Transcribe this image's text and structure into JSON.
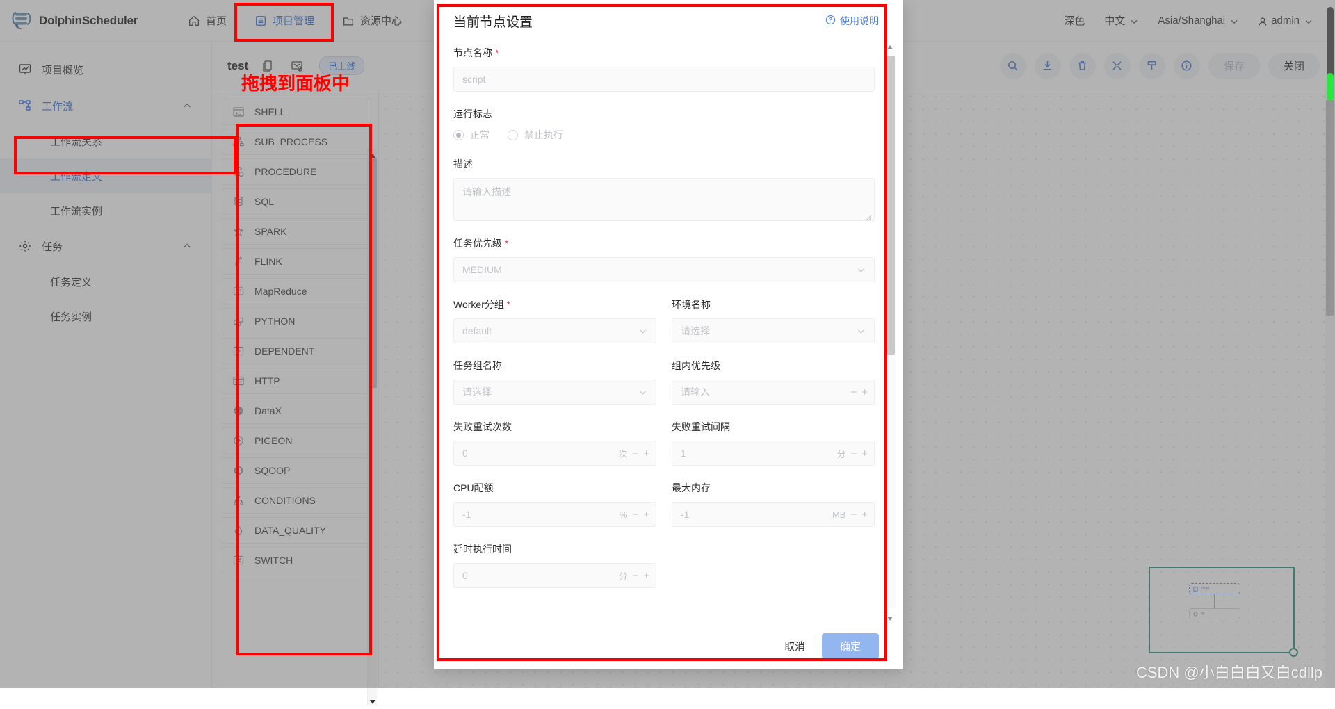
{
  "header": {
    "brand": "DolphinScheduler",
    "nav": [
      {
        "label": "首页",
        "icon": "home-icon",
        "active": false
      },
      {
        "label": "项目管理",
        "icon": "project-icon",
        "active": true
      },
      {
        "label": "资源中心",
        "icon": "folder-icon",
        "active": false
      }
    ],
    "right": {
      "theme": "深色",
      "language": "中文",
      "timezone": "Asia/Shanghai",
      "user": "admin"
    }
  },
  "sidebar": {
    "items": [
      {
        "label": "项目概览",
        "icon": "overview-icon",
        "level": 0,
        "state": "normal"
      },
      {
        "label": "工作流",
        "icon": "workflow-icon",
        "level": 0,
        "state": "active",
        "chevron": "chevron-up"
      },
      {
        "label": "工作流关系",
        "icon": "",
        "level": 1,
        "state": "normal"
      },
      {
        "label": "工作流定义",
        "icon": "",
        "level": 1,
        "state": "selected"
      },
      {
        "label": "工作流实例",
        "icon": "",
        "level": 1,
        "state": "normal"
      },
      {
        "label": "任务",
        "icon": "gear-icon",
        "level": 0,
        "state": "normal",
        "chevron": "chevron-up"
      },
      {
        "label": "任务定义",
        "icon": "",
        "level": 1,
        "state": "normal"
      },
      {
        "label": "任务实例",
        "icon": "",
        "level": 1,
        "state": "normal"
      }
    ]
  },
  "workflow": {
    "name": "test",
    "status_badge": "已上线",
    "toolbar_icons": [
      "search-icon",
      "download-icon",
      "delete-icon",
      "fullscreen-icon",
      "format-icon",
      "info-icon"
    ],
    "save_label": "保存",
    "close_label": "关闭"
  },
  "palette": {
    "items": [
      {
        "label": "SHELL",
        "icon": "shell-icon"
      },
      {
        "label": "SUB_PROCESS",
        "icon": "subprocess-icon"
      },
      {
        "label": "PROCEDURE",
        "icon": "procedure-icon"
      },
      {
        "label": "SQL",
        "icon": "sql-icon"
      },
      {
        "label": "SPARK",
        "icon": "spark-icon"
      },
      {
        "label": "FLINK",
        "icon": "flink-icon"
      },
      {
        "label": "MapReduce",
        "icon": "mapreduce-icon"
      },
      {
        "label": "PYTHON",
        "icon": "python-icon"
      },
      {
        "label": "DEPENDENT",
        "icon": "dependent-icon"
      },
      {
        "label": "HTTP",
        "icon": "http-icon"
      },
      {
        "label": "DataX",
        "icon": "datax-icon"
      },
      {
        "label": "PIGEON",
        "icon": "pigeon-icon"
      },
      {
        "label": "SQOOP",
        "icon": "sqoop-icon"
      },
      {
        "label": "CONDITIONS",
        "icon": "conditions-icon"
      },
      {
        "label": "DATA_QUALITY",
        "icon": "dataquality-icon"
      },
      {
        "label": "SWITCH",
        "icon": "switch-icon"
      }
    ]
  },
  "minimap": {
    "node_a": "script",
    "node_b": "py"
  },
  "modal": {
    "title": "当前节点设置",
    "help_label": "使用说明",
    "fields": {
      "node_name": {
        "label": "节点名称",
        "required": true,
        "placeholder": "script",
        "value": ""
      },
      "run_flag": {
        "label": "运行标志",
        "options": [
          {
            "label": "正常",
            "selected": true
          },
          {
            "label": "禁止执行",
            "selected": false
          }
        ]
      },
      "description": {
        "label": "描述",
        "required": false,
        "placeholder": "请输入描述",
        "value": ""
      },
      "task_priority": {
        "label": "任务优先级",
        "required": true,
        "value": "MEDIUM"
      },
      "worker_group": {
        "label": "Worker分组",
        "required": true,
        "value": "default"
      },
      "environment_name": {
        "label": "环境名称",
        "required": false,
        "placeholder": "请选择",
        "value": ""
      },
      "task_group_name": {
        "label": "任务组名称",
        "required": false,
        "placeholder": "请选择",
        "value": ""
      },
      "group_priority": {
        "label": "组内优先级",
        "required": false,
        "placeholder": "请输入",
        "value": ""
      },
      "failed_retry_times": {
        "label": "失败重试次数",
        "placeholder": "0",
        "unit": "次"
      },
      "failed_retry_interval": {
        "label": "失败重试间隔",
        "placeholder": "1",
        "unit": "分"
      },
      "cpu_quota": {
        "label": "CPU配额",
        "placeholder": "-1",
        "unit": "%"
      },
      "max_memory": {
        "label": "最大内存",
        "placeholder": "-1",
        "unit": "MB"
      },
      "delay_execution_time": {
        "label": "延时执行时间",
        "placeholder": "0",
        "unit": "分"
      }
    },
    "footer": {
      "cancel": "取消",
      "confirm": "确定"
    }
  },
  "annotations": {
    "drag_hint": "拖拽到面板中"
  },
  "watermark": "CSDN @小白白白又白cdllp",
  "colors": {
    "accent_blue": "#2f6fe5",
    "annotation_red": "#ff0000",
    "minimap_green": "#2f8e7e",
    "required_red": "#e8394a"
  }
}
